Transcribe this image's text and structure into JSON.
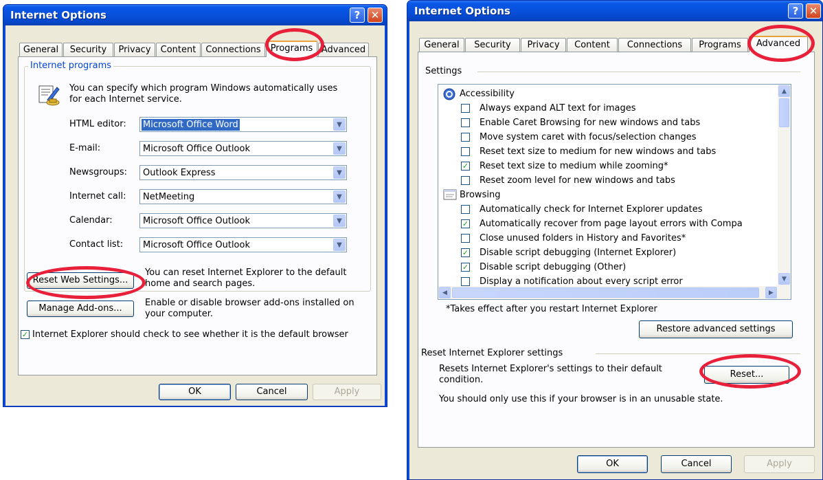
{
  "left_dialog": {
    "title": "Internet Options",
    "tabs": [
      "General",
      "Security",
      "Privacy",
      "Content",
      "Connections",
      "Programs",
      "Advanced"
    ],
    "selected_tab": "Programs",
    "group_label": "Internet programs",
    "intro": "You can specify which program Windows automatically uses",
    "intro2": "for each Internet service.",
    "programs": [
      {
        "label": "HTML editor:",
        "value": "Microsoft Office Word"
      },
      {
        "label": "E-mail:",
        "value": "Microsoft Office Outlook"
      },
      {
        "label": "Newsgroups:",
        "value": "Outlook Express"
      },
      {
        "label": "Internet call:",
        "value": "NetMeeting"
      },
      {
        "label": "Calendar:",
        "value": "Microsoft Office Outlook"
      },
      {
        "label": "Contact list:",
        "value": "Microsoft Office Outlook"
      }
    ],
    "reset_button": "Reset Web Settings...",
    "reset_desc1": "You can reset Internet Explorer to the default",
    "reset_desc2": "home and search pages.",
    "addons_button": "Manage Add-ons...",
    "addons_desc1": "Enable or disable browser add-ons installed on",
    "addons_desc2": "your computer.",
    "default_check_label": "Internet Explorer should check to see whether it is the default browser",
    "default_checked": true,
    "ok": "OK",
    "cancel": "Cancel",
    "apply": "Apply"
  },
  "right_dialog": {
    "title": "Internet Options",
    "tabs": [
      "General",
      "Security",
      "Privacy",
      "Content",
      "Connections",
      "Programs",
      "Advanced"
    ],
    "selected_tab": "Advanced",
    "settings_label": "Settings",
    "settings": [
      {
        "type": "category",
        "label": "Accessibility",
        "icon": "accessibility-icon"
      },
      {
        "type": "check",
        "label": "Always expand ALT text for images",
        "checked": false
      },
      {
        "type": "check",
        "label": "Enable Caret Browsing for new windows and tabs",
        "checked": false
      },
      {
        "type": "check",
        "label": "Move system caret with focus/selection changes",
        "checked": false
      },
      {
        "type": "check",
        "label": "Reset text size to medium for new windows and tabs",
        "checked": false
      },
      {
        "type": "check",
        "label": "Reset text size to medium while zooming*",
        "checked": true
      },
      {
        "type": "check",
        "label": "Reset zoom level for new windows and tabs",
        "checked": false
      },
      {
        "type": "category",
        "label": "Browsing",
        "icon": "browsing-icon"
      },
      {
        "type": "check",
        "label": "Automatically check for Internet Explorer updates",
        "checked": false
      },
      {
        "type": "check",
        "label": "Automatically recover from page layout errors with Compa",
        "checked": true
      },
      {
        "type": "check",
        "label": "Close unused folders in History and Favorites*",
        "checked": false
      },
      {
        "type": "check",
        "label": "Disable script debugging (Internet Explorer)",
        "checked": true
      },
      {
        "type": "check",
        "label": "Disable script debugging (Other)",
        "checked": true
      },
      {
        "type": "check",
        "label": "Display a notification about every script error",
        "checked": false
      }
    ],
    "restart_note": "*Takes effect after you restart Internet Explorer",
    "restore_button": "Restore advanced settings",
    "reset_group_label": "Reset Internet Explorer settings",
    "reset_desc1": "Resets Internet Explorer's settings to their default",
    "reset_desc2": "condition.",
    "reset_button": "Reset...",
    "warning": "You should only use this if your browser is in an unusable state.",
    "ok": "OK",
    "cancel": "Cancel",
    "apply": "Apply"
  },
  "highlight_color": "#e8203a"
}
